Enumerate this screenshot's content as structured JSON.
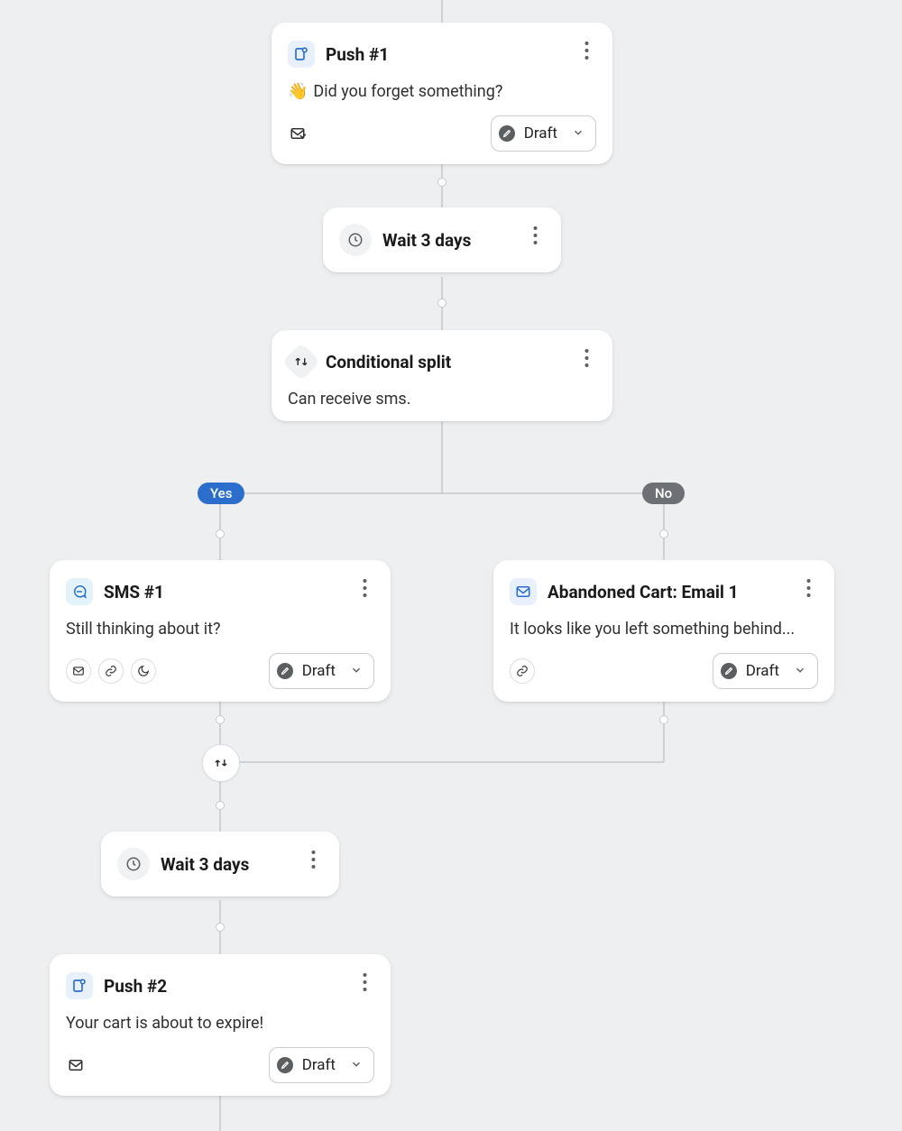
{
  "nodes": {
    "push1": {
      "title": "Push #1",
      "body": "Did you forget something?",
      "status": "Draft",
      "emoji": "👋"
    },
    "wait1": {
      "title": "Wait 3 days"
    },
    "split": {
      "title": "Conditional split",
      "body": "Can receive sms."
    },
    "sms1": {
      "title": "SMS #1",
      "body": "Still thinking about it?",
      "status": "Draft"
    },
    "email1": {
      "title": "Abandoned Cart: Email 1",
      "body": "It looks like you left something behind...",
      "status": "Draft"
    },
    "wait2": {
      "title": "Wait 3 days"
    },
    "push2": {
      "title": "Push #2",
      "body": "Your cart is about to expire!",
      "status": "Draft"
    }
  },
  "branches": {
    "yes": "Yes",
    "no": "No"
  }
}
